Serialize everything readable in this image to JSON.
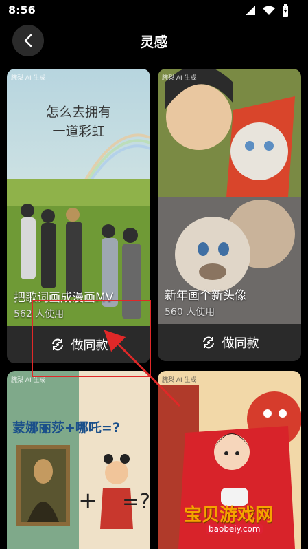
{
  "status": {
    "time": "8:56"
  },
  "header": {
    "title": "灵感"
  },
  "cards": [
    {
      "ai_tag": "腕梨 AI 生成",
      "artwork_text_line1": "怎么去拥有",
      "artwork_text_line2": "一道彩虹",
      "title": "把歌词画成漫画MV",
      "usage": "562 人使用",
      "button": "做同款"
    },
    {
      "ai_tag": "腕梨 AI 生成",
      "title": "新年画个新头像",
      "usage": "560 人使用",
      "button": "做同款"
    },
    {
      "ai_tag": "腕梨 AI 生成",
      "artwork_text": "蒙娜丽莎+哪吒=?"
    },
    {
      "ai_tag": "腕梨 AI 生成"
    }
  ],
  "watermark": {
    "text": "宝贝游戏网",
    "url": "baobeiy.com"
  },
  "colors": {
    "background": "#000000",
    "card": "#2a2a2a",
    "annotation": "#e02828"
  }
}
